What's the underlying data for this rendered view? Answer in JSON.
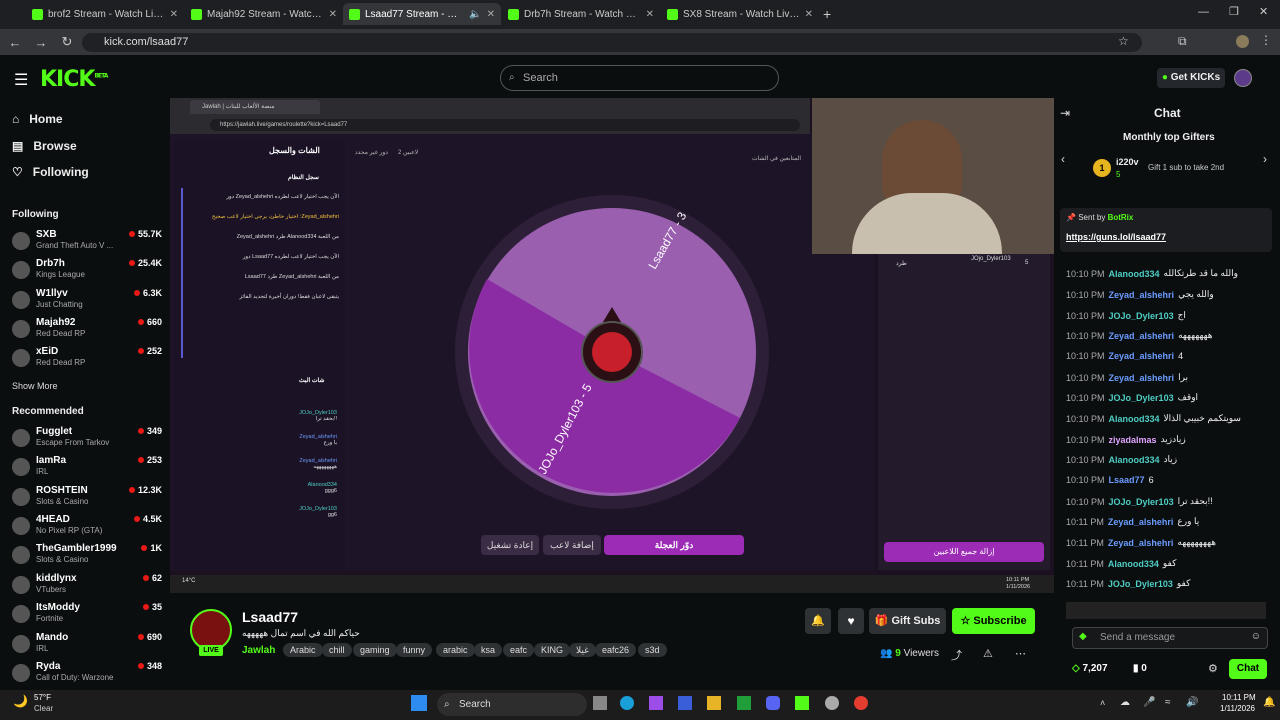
{
  "browser": {
    "tabs": [
      {
        "title": "brof2 Stream - Watch Live on K"
      },
      {
        "title": "Majah92 Stream - Watch Live o"
      },
      {
        "title": "Lsaad77 Stream - Watch Liv"
      },
      {
        "title": "Drb7h Stream - Watch Live on"
      },
      {
        "title": "SX8 Stream - Watch Live on Ki"
      }
    ],
    "url": "kick.com/lsaad77"
  },
  "header": {
    "logo": "KICK",
    "logo_sup": "BETA",
    "search_placeholder": "Search",
    "get_kicks": "Get KICKs"
  },
  "sidebar": {
    "nav": [
      {
        "label": "Home",
        "icon": "home-icon"
      },
      {
        "label": "Browse",
        "icon": "browse-icon"
      },
      {
        "label": "Following",
        "icon": "heart-icon"
      }
    ],
    "following_title": "Following",
    "following": [
      {
        "name": "SXB",
        "category": "Grand Theft Auto V ...",
        "viewers": "55.7K"
      },
      {
        "name": "Drb7h",
        "category": "Kings League",
        "viewers": "25.4K"
      },
      {
        "name": "W1llyv",
        "category": "Just Chatting",
        "viewers": "6.3K"
      },
      {
        "name": "Majah92",
        "category": "Red Dead RP",
        "viewers": "660"
      },
      {
        "name": "xEiD",
        "category": "Red Dead RP",
        "viewers": "252"
      }
    ],
    "show_more": "Show More",
    "recommended_title": "Recommended",
    "recommended": [
      {
        "name": "Fugglet",
        "category": "Escape From Tarkov",
        "viewers": "349"
      },
      {
        "name": "IamRa",
        "category": "IRL",
        "viewers": "253"
      },
      {
        "name": "ROSHTEIN",
        "category": "Slots & Casino",
        "viewers": "12.3K"
      },
      {
        "name": "4HEAD",
        "category": "No Pixel RP (GTA)",
        "viewers": "4.5K"
      },
      {
        "name": "TheGambler1999",
        "category": "Slots & Casino",
        "viewers": "1K"
      },
      {
        "name": "kiddlynx",
        "category": "VTubers",
        "viewers": "62"
      },
      {
        "name": "ItsModdy",
        "category": "Fortnite",
        "viewers": "35"
      },
      {
        "name": "Mando",
        "category": "IRL",
        "viewers": "690"
      },
      {
        "name": "Ryda",
        "category": "Call of Duty: Warzone",
        "viewers": "348"
      }
    ]
  },
  "stream": {
    "inner_url": "https://jawlah.live/games/roulette?kick=Lsaad77",
    "inner_tab": "Jawlah | منصة الألعاب للبثات",
    "chat_log_title": "الشات والسجل",
    "system_log_title": "سجل النظام",
    "live_chat_title": "شات البث",
    "players_count": "2 لاعبين",
    "round_label": "دور غير محدد",
    "followers_chat": "المتابعين في الشات",
    "wheel_labels": [
      "Lsaad77 - 3",
      "JOJo_Dyler103 - 5"
    ],
    "spin_button": "دوّر العجلة",
    "add_player": "إضافة لاعب",
    "restart": "إعادة تشغيل",
    "remove_all": "إزالة جميع اللاعبين",
    "right_player": "JOjo_Dyler103",
    "right_player_score": "5",
    "right_player_action": "طرد",
    "system_msgs": [
      "دور Zeyad_alshehri الآن يجب اختيار لاعب لطرده",
      "اختيار خاطئ، يرجى اختيار لاعب صحيح :Zeyad_alshehri",
      "Zeyad_alshehri طرد Alanood334 من اللعبة",
      "دور Lsaad77 الآن يجب اختيار لاعب لطرده",
      "Lsaad77 طرد Zeyad_alshehri من اللعبة",
      "يتبقى لاعبان فقط! دوران أخيرة لتحديد الفائز"
    ],
    "live_msgs": [
      {
        "user": "JOJo_Dyler103",
        "text": "بحقد ترا!!"
      },
      {
        "user": "Zeyad_alshehri",
        "text": "يا ورع"
      },
      {
        "user": "Zeyad_alshehri",
        "text": "ههههههههه"
      },
      {
        "user": "Alanood334",
        "text": "ggg6"
      },
      {
        "user": "JOJo_Dyler103",
        "text": "gg6"
      }
    ],
    "streamer": "Lsaad77",
    "live_badge": "LIVE",
    "stream_title": "حياكم الله في اسم تمال هههههه",
    "category": "Jawlah",
    "tags": [
      "Arabic",
      "chill",
      "gaming",
      "funny",
      "arabic",
      "ksa",
      "eafc",
      "KING",
      "غيلا",
      "eafc26",
      "s3d"
    ],
    "gift_subs": "Gift Subs",
    "subscribe": "Subscribe",
    "viewers": "9",
    "viewers_label": "Viewers",
    "inner_time": "10:11 PM",
    "inner_date": "1/11/2026",
    "inner_weather": "14°C"
  },
  "chat": {
    "title": "Chat",
    "top_gifters": "Monthly top Gifters",
    "gifter_name": "i220v",
    "gifter_count": "5",
    "gifter_note": "Gift 1 sub to take 2nd",
    "pinned_by": "Sent by",
    "pinned_user": "BotRix",
    "pinned_link": "https://guns.lol/lsaad77",
    "messages": [
      {
        "time": "10:10 PM",
        "user": "Alanood334",
        "text": "والله ما قد طرتكالله",
        "color": "#4ecdc4"
      },
      {
        "time": "10:10 PM",
        "user": "Zeyad_alshehri",
        "text": "والله يجي",
        "color": "#6b9cff"
      },
      {
        "time": "10:10 PM",
        "user": "JOJo_Dyler103",
        "text": "اج",
        "color": "#4ecdc4"
      },
      {
        "time": "10:10 PM",
        "user": "Zeyad_alshehri",
        "text": "هههههههه",
        "color": "#6b9cff"
      },
      {
        "time": "10:10 PM",
        "user": "Zeyad_alshehri",
        "text": "4",
        "color": "#6b9cff"
      },
      {
        "time": "10:10 PM",
        "user": "Zeyad_alshehri",
        "text": "برا",
        "color": "#6b9cff"
      },
      {
        "time": "10:10 PM",
        "user": "JOJo_Dyler103",
        "text": "اوقف",
        "color": "#4ecdc4"
      },
      {
        "time": "10:10 PM",
        "user": "Alanood334",
        "text": "سويتكمم خبيبي الذالا",
        "color": "#4ecdc4"
      },
      {
        "time": "10:10 PM",
        "user": "ziyadalmas",
        "text": "زيادزيد",
        "color": "#e0a3ff"
      },
      {
        "time": "10:10 PM",
        "user": "Alanood334",
        "text": "زياد",
        "color": "#4ecdc4"
      },
      {
        "time": "10:10 PM",
        "user": "Lsaad77",
        "text": "6",
        "color": "#6b9cff"
      },
      {
        "time": "10:10 PM",
        "user": "JOJo_Dyler103",
        "text": "بحقد ترا!!",
        "color": "#4ecdc4"
      },
      {
        "time": "10:11 PM",
        "user": "Zeyad_alshehri",
        "text": "يا ورع",
        "color": "#6b9cff"
      },
      {
        "time": "10:11 PM",
        "user": "Zeyad_alshehri",
        "text": "ههههههههه",
        "color": "#6b9cff"
      },
      {
        "time": "10:11 PM",
        "user": "Alanood334",
        "text": "كفو",
        "color": "#4ecdc4"
      },
      {
        "time": "10:11 PM",
        "user": "JOJo_Dyler103",
        "text": "كفو",
        "color": "#4ecdc4"
      }
    ],
    "send_placeholder": "Send a message",
    "points": "7,207",
    "zero": "0",
    "chat_button": "Chat"
  },
  "taskbar": {
    "weather_temp": "57°F",
    "weather_desc": "Clear",
    "search": "Search",
    "time": "10:11 PM",
    "date": "1/11/2026"
  },
  "colors": {
    "brand": "#53fc18",
    "live": "#e91916",
    "wheel_light": "#9b5fb0",
    "wheel_dark": "#8c2ca5"
  }
}
